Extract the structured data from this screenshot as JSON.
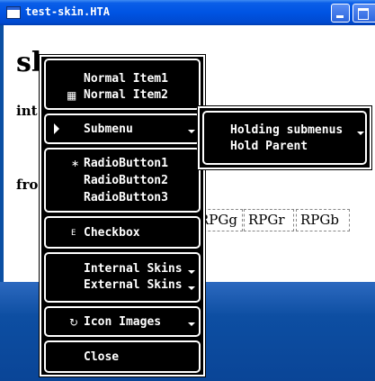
{
  "window": {
    "title": "test-skin.HTA"
  },
  "page": {
    "heading": "sk",
    "text_intro": "int",
    "text_from": "fro",
    "boxes": [
      "RPGg",
      "RPGr",
      "RPGb"
    ]
  },
  "menu": {
    "items": {
      "normal1": "Normal Item1",
      "normal2": "Normal Item2",
      "submenu": "Submenu",
      "radio1": "RadioButton1",
      "radio2": "RadioButton2",
      "radio3": "RadioButton3",
      "checkbox": "Checkbox",
      "internal_skins": "Internal Skins",
      "external_skins": "External Skins",
      "icon_images": "Icon Images",
      "close": "Close"
    },
    "icons": {
      "normal2": "grid-icon",
      "submenu": "play-icon",
      "radio1": "radio-bullet-icon",
      "checkbox": "check-mark-icon",
      "icon_images": "refresh-icon"
    }
  },
  "submenu": {
    "items": {
      "holding": "Holding submenus",
      "hold_parent": "Hold Parent"
    }
  },
  "colors": {
    "menu_bg": "#000000",
    "menu_fg": "#ffffff",
    "titlebar": "#0054e3"
  }
}
